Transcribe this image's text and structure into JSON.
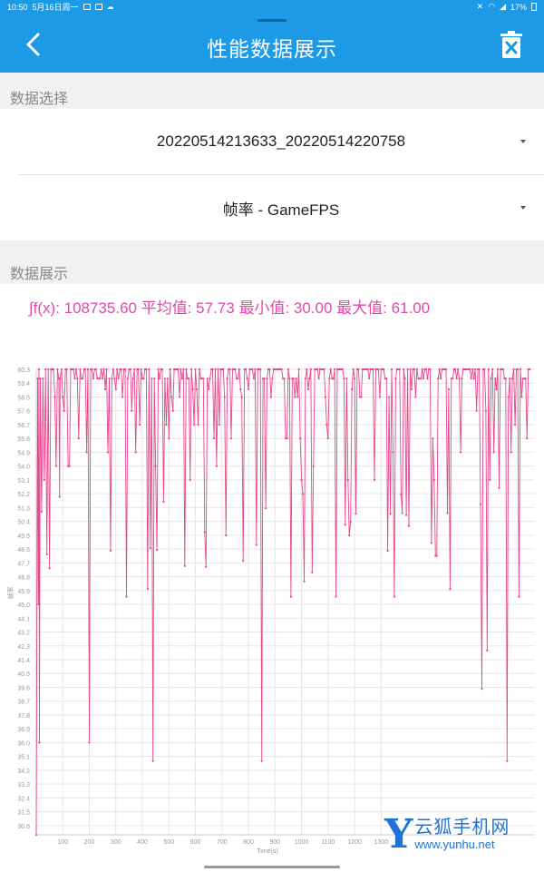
{
  "status_bar": {
    "time": "10:50",
    "date": "5月16日周一",
    "battery": "17%"
  },
  "header": {
    "title": "性能数据展示"
  },
  "data_select": {
    "label": "数据选择",
    "session": "20220514213633_20220514220758",
    "metric": "帧率 - GameFPS"
  },
  "data_display": {
    "label": "数据展示",
    "stats": "∫f(x): 108735.60 平均值: 57.73 最小值: 30.00 最大值: 61.00"
  },
  "chart_data": {
    "type": "line",
    "title": "",
    "xlabel": "Time(s)",
    "ylabel": "帧率",
    "xlim": [
      0,
      1880
    ],
    "ylim": [
      30,
      60.3
    ],
    "x_ticks": [
      100,
      200,
      300,
      400,
      500,
      600,
      700,
      800,
      900,
      1000,
      1100,
      1200,
      1300
    ],
    "y_ticks": [
      60.3,
      59.4,
      58.5,
      57.6,
      56.7,
      55.8,
      54.9,
      54.0,
      53.1,
      52.2,
      51.3,
      50.4,
      49.5,
      48.6,
      47.7,
      46.8,
      45.9,
      45.0,
      44.1,
      43.2,
      42.3,
      41.4,
      40.5,
      39.6,
      38.7,
      37.8,
      36.9,
      36.0,
      35.1,
      34.2,
      33.3,
      32.4,
      31.5,
      30.6
    ],
    "color": "#e8458b",
    "series": [
      {
        "values": [
          {
            "x": 0,
            "y": 30.0
          },
          {
            "x": 8,
            "y": 45.0
          },
          {
            "x": 12,
            "y": 36.0
          },
          {
            "x": 88,
            "y": 52.0
          },
          {
            "x": 200,
            "y": 36.0
          },
          {
            "x": 340,
            "y": 45.5
          },
          {
            "x": 420,
            "y": 46.0
          },
          {
            "x": 440,
            "y": 34.8
          },
          {
            "x": 560,
            "y": 47.5
          },
          {
            "x": 715,
            "y": 49.5
          },
          {
            "x": 850,
            "y": 34.8
          },
          {
            "x": 960,
            "y": 45.5
          },
          {
            "x": 1010,
            "y": 46.5
          },
          {
            "x": 1130,
            "y": 45.5
          },
          {
            "x": 1180,
            "y": 49.5
          },
          {
            "x": 1350,
            "y": 45.5
          },
          {
            "x": 1490,
            "y": 49.0
          },
          {
            "x": 1560,
            "y": 46.0
          },
          {
            "x": 1680,
            "y": 39.5
          },
          {
            "x": 1700,
            "y": 42.0
          },
          {
            "x": 1775,
            "y": 34.8
          },
          {
            "x": 1820,
            "y": 45.5
          }
        ]
      }
    ]
  },
  "watermark": {
    "letter": "Y",
    "name": "云狐手机网",
    "url": "www.yunhu.net"
  }
}
